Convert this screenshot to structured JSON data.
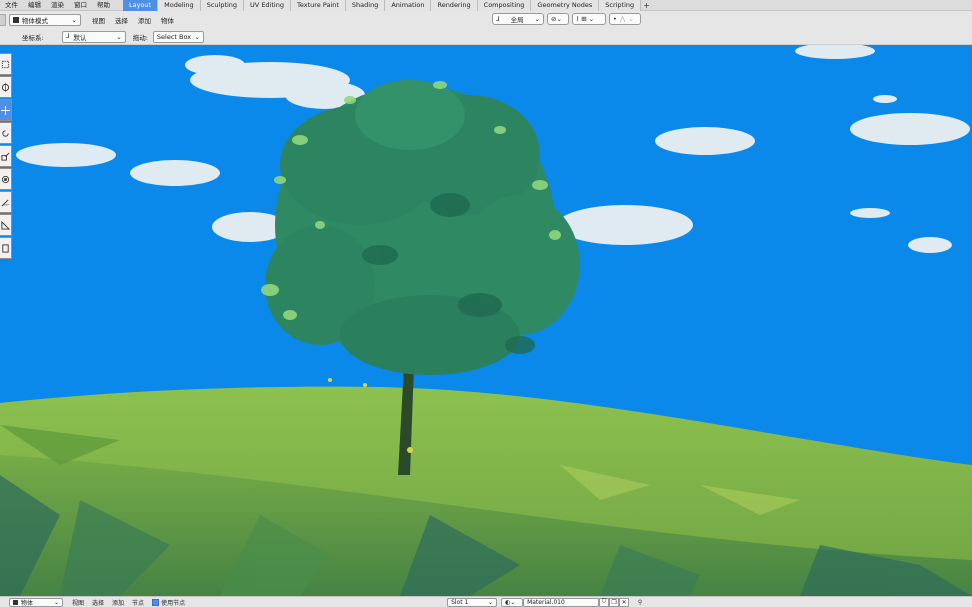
{
  "top_menu": {
    "items": [
      "文件",
      "编辑",
      "渲染",
      "窗口",
      "帮助"
    ],
    "workspaces": [
      {
        "label": "Layout",
        "active": true
      },
      {
        "label": "Modeling",
        "active": false
      },
      {
        "label": "Sculpting",
        "active": false
      },
      {
        "label": "UV Editing",
        "active": false
      },
      {
        "label": "Texture Paint",
        "active": false
      },
      {
        "label": "Shading",
        "active": false
      },
      {
        "label": "Animation",
        "active": false
      },
      {
        "label": "Rendering",
        "active": false
      },
      {
        "label": "Compositing",
        "active": false
      },
      {
        "label": "Geometry Nodes",
        "active": false
      },
      {
        "label": "Scripting",
        "active": false
      }
    ],
    "add_workspace": "+"
  },
  "header": {
    "mode": "物体模式",
    "menus": [
      "视图",
      "选择",
      "添加",
      "物体"
    ],
    "transform_orientation": "全局",
    "coord_label": "坐标系:",
    "coord_value": "默认",
    "drag_label": "拖动:",
    "drag_value": "Select Box"
  },
  "toolbar": {
    "tools": [
      {
        "name": "select-box-tool",
        "icon": "select-box-icon",
        "active": false
      },
      {
        "name": "cursor-tool",
        "icon": "cursor-icon",
        "active": false
      },
      {
        "name": "move-tool",
        "icon": "move-icon",
        "active": true
      },
      {
        "name": "rotate-tool",
        "icon": "rotate-icon",
        "active": false
      },
      {
        "name": "scale-tool",
        "icon": "scale-icon",
        "active": false
      },
      {
        "name": "transform-tool",
        "icon": "transform-icon",
        "active": false
      },
      {
        "name": "annotate-tool",
        "icon": "annotate-icon",
        "active": false
      },
      {
        "name": "measure-tool",
        "icon": "measure-icon",
        "active": false
      },
      {
        "name": "add-cube-tool",
        "icon": "add-cube-icon",
        "active": false
      }
    ]
  },
  "bottom": {
    "editor_mode": "物体",
    "menus": [
      "视图",
      "选择",
      "添加",
      "节点"
    ],
    "use_nodes_label": "使用节点",
    "slot": "Slot 1",
    "material": "Material.010"
  },
  "colors": {
    "accent": "#4f8fe6",
    "sky": "#0a89ea",
    "grass": "#7fb24a",
    "foliage": "#2f8a64"
  }
}
